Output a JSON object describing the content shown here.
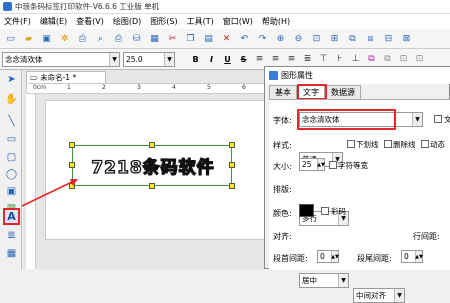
{
  "app": {
    "title": "中琅条码标签打印软件-V6.6.6 工业版 单机"
  },
  "menu": {
    "items": [
      "文件(F)",
      "编辑(E)",
      "查看(V)",
      "绘图(D)",
      "图形(S)",
      "工具(T)",
      "窗口(W)",
      "帮助(H)"
    ]
  },
  "format_bar": {
    "font_name": "念念清欢体",
    "font_size": "25.0",
    "bold": "B",
    "italic": "I",
    "underline": "U",
    "strike": "S"
  },
  "document": {
    "tab_label": "未命名-1 *",
    "ruler_labels": [
      "0cm",
      "1",
      "2",
      "3",
      "4",
      "5",
      "6",
      "7"
    ]
  },
  "canvas": {
    "text_object": "7218条码软件"
  },
  "dialog": {
    "title": "图形属性",
    "tabs": [
      "基本",
      "文字",
      "数据源"
    ],
    "active_tab": "文字",
    "font_label": "字体:",
    "font_value": "念念清欢体",
    "font_extra": "文",
    "style_label": "样式:",
    "style_value": "普通",
    "underline_label": "下划线",
    "strike_label": "删除线",
    "dynamic_label": "动态",
    "size_label": "大小:",
    "size_value": "25",
    "equal_width_label": "字符等宽",
    "layout_label": "排版:",
    "layout_value": "多行",
    "color_label": "颜色:",
    "color_value": "#000000",
    "color_checkbox_label": "彩码",
    "align_label": "对齐:",
    "align_h_value": "居中",
    "align_v_value": "中间对齐",
    "line_spacing_label": "行间距:",
    "para_before_label": "段首间距:",
    "para_before_value": "0",
    "para_after_label": "段尾间距:",
    "para_after_value": "0"
  },
  "colors": {
    "highlight": "#e0282a",
    "accent": "#2866b8"
  }
}
